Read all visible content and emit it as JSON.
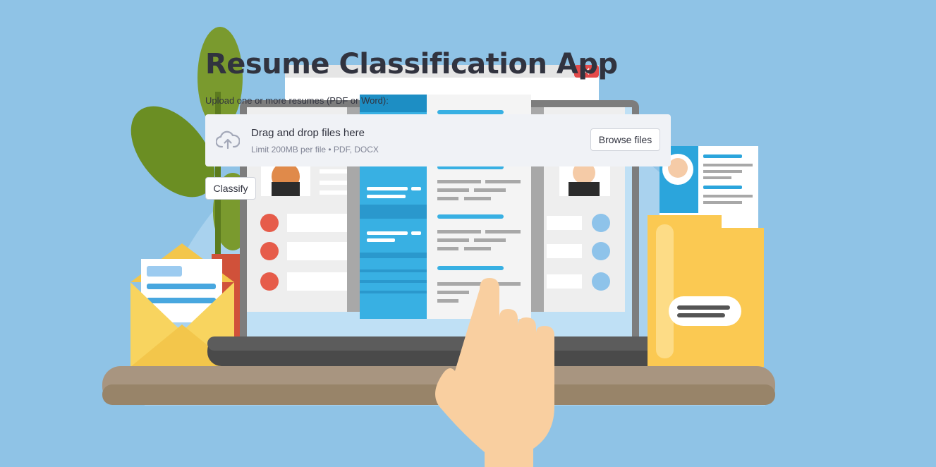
{
  "app": {
    "title": "Resume Classification App"
  },
  "uploader": {
    "label": "Upload one or more resumes (PDF or Word):",
    "dropzone_title": "Drag and drop files here",
    "dropzone_limit": "Limit 200MB per file • PDF, DOCX",
    "browse_label": "Browse files",
    "icon": "cloud-upload-icon"
  },
  "actions": {
    "classify_label": "Classify"
  },
  "colors": {
    "background": "#8fc3e6",
    "text": "#31333f",
    "dropzone_bg": "#f0f2f6",
    "muted_text": "#808495"
  }
}
